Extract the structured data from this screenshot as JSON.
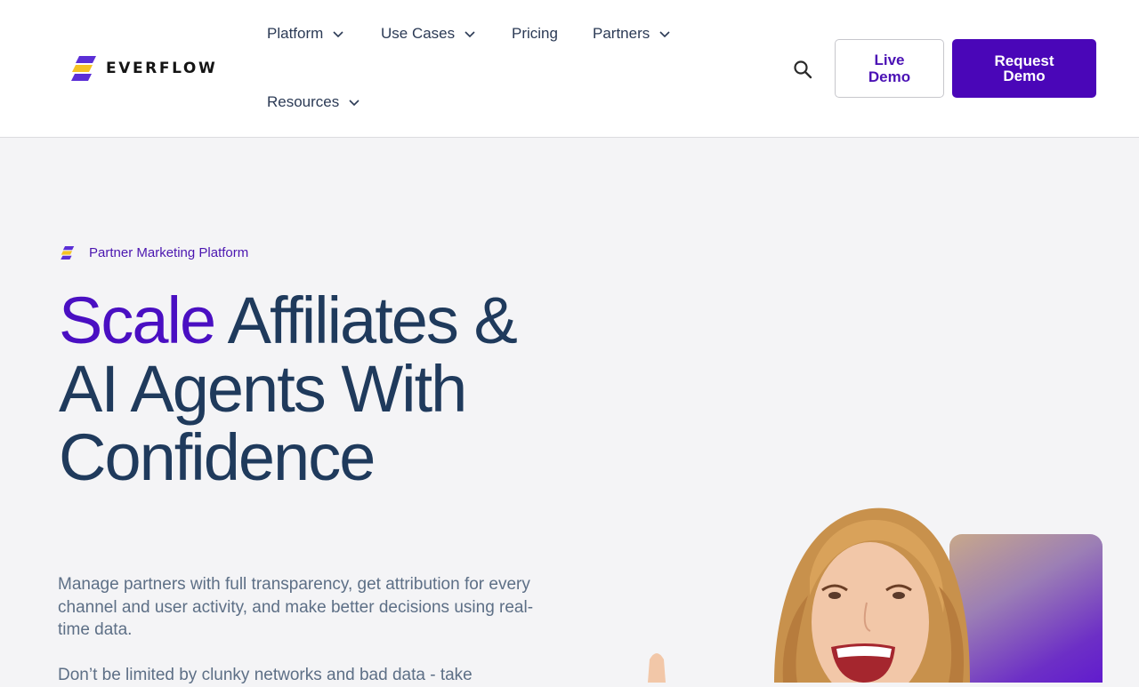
{
  "header": {
    "logo_text": "EVERFLOW",
    "nav": {
      "platform": "Platform",
      "use_cases": "Use Cases",
      "pricing": "Pricing",
      "partners": "Partners",
      "resources": "Resources"
    },
    "search_icon": "search-icon",
    "live_demo": "Live Demo",
    "request_demo": "Request Demo"
  },
  "hero": {
    "eyebrow": "Partner Marketing Platform",
    "headline_accent": "Scale",
    "headline_rest": " Affiliates & AI Agents With Confidence",
    "description": "Manage partners with full transparency, get attribution for every channel and user activity, and make better decisions using real-time data.",
    "description_2": "Don’t be limited by clunky networks and bad data - take"
  },
  "colors": {
    "brand_purple": "#4a06b8",
    "headline_navy": "#1f3a5c",
    "logo_yellow": "#f5c324",
    "logo_purple": "#5b2fd6"
  }
}
